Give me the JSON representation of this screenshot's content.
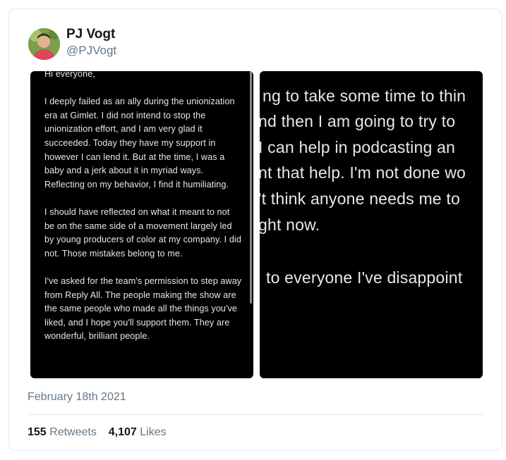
{
  "author": {
    "name": "PJ Vogt",
    "handle": "@PJVogt"
  },
  "media": {
    "note_paragraphs": [
      "Hi everyone,",
      "I deeply failed as an ally during the unionization era at Gimlet. I did not intend to stop the unionization effort, and I am very glad it succeeded. Today they have my support in however I can lend it. But at the time, I was a baby and a jerk about it in myriad ways. Reflecting on my behavior, I find it humiliating.",
      "I should have reflected on what it meant to not be on the same side of a movement largely led by young producers of color at my company. I did not. Those mistakes belong to me.",
      "I've asked for the team's permission to step away from Reply All. The people making the show are the same people who made all the things you've liked, and I hope you'll support them. They are wonderful, brilliant people."
    ],
    "zoomed_lines": [
      "ng to take some time to thin",
      "nd then I am going to try to",
      "I can help in podcasting an",
      "nt that help. I'm not done wo",
      "'t think anyone needs me to",
      "ght now.",
      "to everyone I've disappoint"
    ]
  },
  "date": "February 18th 2021",
  "stats": {
    "retweets_count": "155",
    "retweets_label": "Retweets",
    "likes_count": "4,107",
    "likes_label": "Likes"
  }
}
